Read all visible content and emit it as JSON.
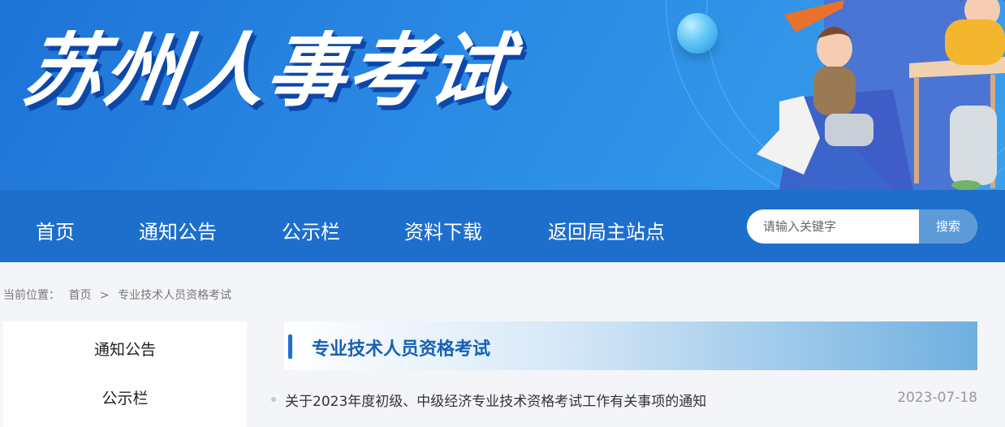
{
  "banner": {
    "title": "苏州人事考试"
  },
  "nav": {
    "items": [
      "首页",
      "通知公告",
      "公示栏",
      "资料下载",
      "返回局主站点"
    ],
    "search_placeholder": "请输入关键字",
    "search_button": "搜索"
  },
  "breadcrumb": {
    "prefix": "当前位置：",
    "home": "首页",
    "sep": ">",
    "current": "专业技术人员资格考试"
  },
  "sidebar": {
    "items": [
      "通知公告",
      "公示栏"
    ]
  },
  "main": {
    "heading": "专业技术人员资格考试",
    "articles": [
      {
        "title": "关于2023年度初级、中级经济专业技术资格考试工作有关事项的通知",
        "date": "2023-07-18"
      }
    ]
  },
  "colors": {
    "nav": "#1e6fcc",
    "heading": "#1761b4",
    "banner": "#2a8ae4"
  }
}
